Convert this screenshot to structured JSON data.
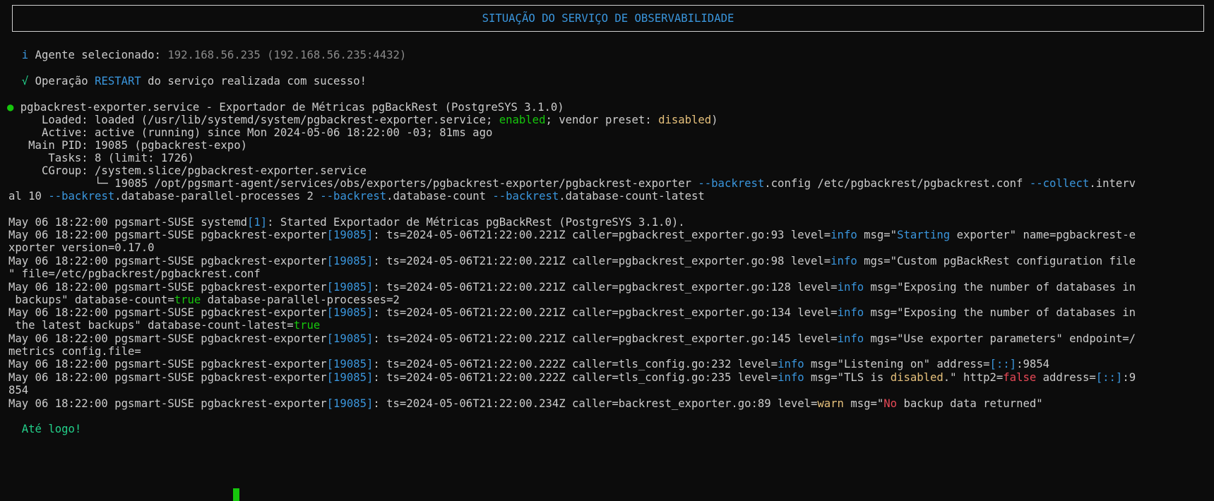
{
  "header": {
    "title": "SITUAÇÃO DO SERVIÇO DE OBSERVABILIDADE"
  },
  "agent": {
    "icon": "i",
    "label": "Agente selecionado:",
    "value": "192.168.56.235 (192.168.56.235:4432)"
  },
  "op": {
    "icon": "√",
    "pre": "Operação",
    "action": "RESTART",
    "post": "do serviço realizada com sucesso!"
  },
  "status": {
    "line1": "pgbackrest-exporter.service - Exportador de Métricas pgBackRest (PostgreSYS 3.1.0)",
    "loaded_pre": "     Loaded: loaded (/usr/lib/systemd/system/pgbackrest-exporter.service; ",
    "loaded_enabled": "enabled",
    "loaded_mid": "; vendor preset: ",
    "loaded_disabled": "disabled",
    "loaded_end": ")",
    "active": "     Active: active (running) since Mon 2024-05-06 18:22:00 -03; 81ms ago",
    "mainpid": "   Main PID: 19085 (pgbackrest-expo)",
    "tasks": "      Tasks: 8 (limit: 1726)",
    "cgroup": "     CGroup: /system.slice/pgbackrest-exporter.service",
    "proc_pre": "             └─ 19085 /opt/pgsmart-agent/services/obs/exporters/pgbackrest-exporter/pgbackrest-exporter ",
    "proc_f1": "--backrest",
    "proc_t1": ".config /etc/pgbackrest/pgbackrest.conf ",
    "proc_f2": "--collect",
    "proc_t2": ".interv",
    "proc2_pre": "al 10 ",
    "proc2_f1": "--backrest",
    "proc2_t1": ".database-parallel-processes 2 ",
    "proc2_f2": "--backrest",
    "proc2_t2": ".database-count ",
    "proc2_f3": "--backrest",
    "proc2_t3": ".database-count-latest"
  },
  "log": {
    "prefix": "May 06 18:22:00 pgsmart-SUSE ",
    "l1a": "systemd",
    "l1b": "[1]",
    "l1c": ": Started Exportador de Métricas pgBackRest (PostgreSYS 3.1.0).",
    "proc": "pgbackrest-exporter",
    "pid": "[19085]",
    "l2a": ": ts=2024-05-06T21:22:00.221Z caller=pgbackrest_exporter.go:93 level=",
    "info": "info",
    "l2b": " msg=\"",
    "l2c": "Starting",
    "l2d": " exporter\" name=pgbackrest-e",
    "l2e": "xporter version=0.17.0",
    "l3a": ": ts=2024-05-06T21:22:00.221Z caller=pgbackrest_exporter.go:98 level=",
    "l3b": " mgs=\"Custom pgBackRest configuration file",
    "l3c": "\" file=/etc/pgbackrest/pgbackrest.conf",
    "l4a": ": ts=2024-05-06T21:22:00.221Z caller=pgbackrest_exporter.go:128 level=",
    "l4b": " msg=\"Exposing the number of databases in",
    "l4c": " backups\" database-count=",
    "true": "true",
    "l4d": " database-parallel-processes=2",
    "l5a": ": ts=2024-05-06T21:22:00.221Z caller=pgbackrest_exporter.go:134 level=",
    "l5b": " msg=\"Exposing the number of databases in",
    "l5c": " the latest backups\" database-count-latest=",
    "l6a": ": ts=2024-05-06T21:22:00.221Z caller=pgbackrest_exporter.go:145 level=",
    "l6b": " mgs=\"Use exporter parameters\" endpoint=/",
    "l6c": "metrics config.file=",
    "l7a": ": ts=2024-05-06T21:22:00.222Z caller=tls_config.go:232 level=",
    "l7b": " msg=\"Listening on\" address=",
    "addr": "[::]",
    "l7c": ":9854",
    "l8a": ": ts=2024-05-06T21:22:00.222Z caller=tls_config.go:235 level=",
    "l8b": " msg=\"TLS is ",
    "disabled": "disabled",
    "l8c": ".\" http2=",
    "false": "false",
    "l8d": " address=",
    "l8e": ":9",
    "l8f": "854",
    "l9a": ": ts=2024-05-06T21:22:00.234Z caller=backrest_exporter.go:89 level=",
    "warn": "warn",
    "l9b": " msg=\"",
    "no": "No",
    "l9c": " backup data returned\""
  },
  "footer": {
    "bye": "Até logo!"
  }
}
